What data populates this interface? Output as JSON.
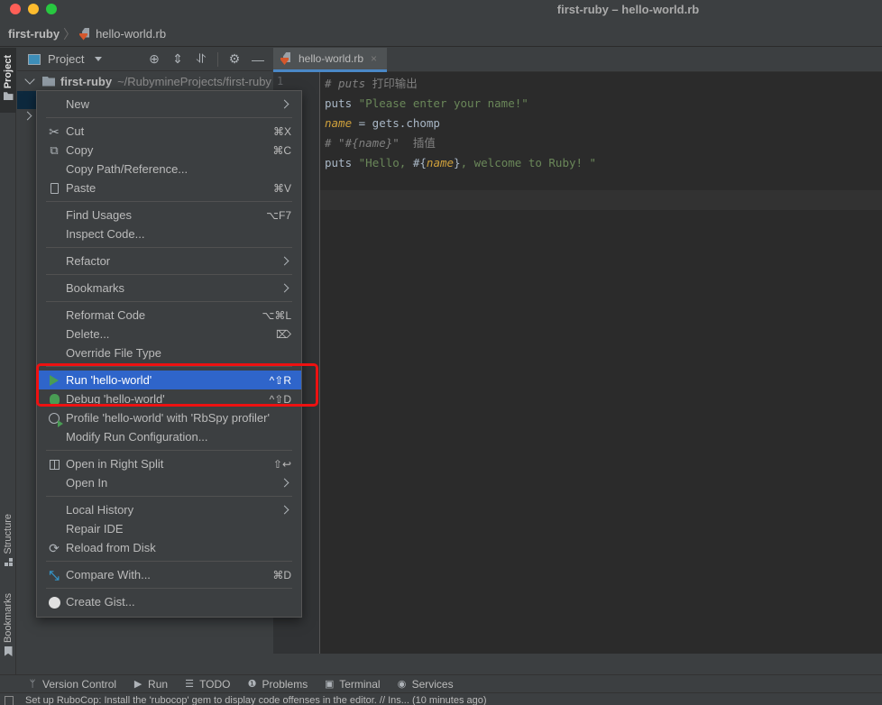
{
  "window": {
    "title": "first-ruby – hello-world.rb"
  },
  "breadcrumb": {
    "project": "first-ruby",
    "separator": "〉",
    "file": "hello-world.rb"
  },
  "left_stripe": {
    "tabs": [
      {
        "label": "Project",
        "icon": "folder-icon",
        "active": true
      },
      {
        "label": "Structure",
        "icon": "structure-icon",
        "active": false
      },
      {
        "label": "Bookmarks",
        "icon": "bookmark-icon",
        "active": false
      }
    ]
  },
  "project_panel": {
    "title": "Project",
    "tools": [
      "locate-icon",
      "expand-all-icon",
      "collapse-all-icon",
      "gear-icon",
      "hide-icon"
    ],
    "root": {
      "name": "first-ruby",
      "path": "~/RubymineProjects/first-ruby"
    }
  },
  "editor": {
    "tab_label": "hello-world.rb",
    "close_glyph": "×",
    "line_number": "1",
    "lines": [
      [
        {
          "t": "# puts ",
          "c": "comment"
        },
        {
          "t": "打印输出",
          "c": "comment-cjk"
        }
      ],
      [
        {
          "t": "puts ",
          "c": "kw"
        },
        {
          "t": "\"Please enter your name!\"",
          "c": "str"
        }
      ],
      [
        {
          "t": "name",
          "c": "var"
        },
        {
          "t": " = gets.chomp",
          "c": "plain"
        }
      ],
      [
        {
          "t": "# \"#{name}\"  ",
          "c": "comment"
        },
        {
          "t": "插值",
          "c": "comment-cjk"
        }
      ],
      [
        {
          "t": "puts ",
          "c": "kw"
        },
        {
          "t": "\"Hello, ",
          "c": "str"
        },
        {
          "t": "#{",
          "c": "plain"
        },
        {
          "t": "name",
          "c": "var"
        },
        {
          "t": "}",
          "c": "plain"
        },
        {
          "t": ", welcome to Ruby! \"",
          "c": "str"
        }
      ]
    ]
  },
  "context_menu": {
    "items": [
      {
        "type": "item",
        "label": "New",
        "submenu": true
      },
      {
        "type": "sep"
      },
      {
        "type": "item",
        "label": "Cut",
        "shortcut": "⌘X",
        "icon": "scissors-icon"
      },
      {
        "type": "item",
        "label": "Copy",
        "shortcut": "⌘C",
        "icon": "copy-icon"
      },
      {
        "type": "item",
        "label": "Copy Path/Reference..."
      },
      {
        "type": "item",
        "label": "Paste",
        "shortcut": "⌘V",
        "icon": "paste-icon"
      },
      {
        "type": "sep"
      },
      {
        "type": "item",
        "label": "Find Usages",
        "shortcut": "⌥F7"
      },
      {
        "type": "item",
        "label": "Inspect Code..."
      },
      {
        "type": "sep"
      },
      {
        "type": "item",
        "label": "Refactor",
        "submenu": true
      },
      {
        "type": "sep"
      },
      {
        "type": "item",
        "label": "Bookmarks",
        "submenu": true
      },
      {
        "type": "sep"
      },
      {
        "type": "item",
        "label": "Reformat Code",
        "shortcut": "⌥⌘L"
      },
      {
        "type": "item",
        "label": "Delete...",
        "shortcut": "⌦"
      },
      {
        "type": "item",
        "label": "Override File Type"
      },
      {
        "type": "sep"
      },
      {
        "type": "item",
        "label": "Run 'hello-world'",
        "shortcut": "^⇧R",
        "icon": "run-icon",
        "selected": true
      },
      {
        "type": "item",
        "label": "Debug 'hello-world'",
        "shortcut": "^⇧D",
        "icon": "debug-icon"
      },
      {
        "type": "item",
        "label": "Profile 'hello-world' with 'RbSpy profiler'",
        "icon": "profile-icon"
      },
      {
        "type": "item",
        "label": "Modify Run Configuration..."
      },
      {
        "type": "sep"
      },
      {
        "type": "item",
        "label": "Open in Right Split",
        "shortcut": "⇧↩",
        "icon": "split-icon"
      },
      {
        "type": "item",
        "label": "Open In",
        "submenu": true
      },
      {
        "type": "sep"
      },
      {
        "type": "item",
        "label": "Local History",
        "submenu": true
      },
      {
        "type": "item",
        "label": "Repair IDE"
      },
      {
        "type": "item",
        "label": "Reload from Disk",
        "icon": "reload-icon"
      },
      {
        "type": "sep"
      },
      {
        "type": "item",
        "label": "Compare With...",
        "shortcut": "⌘D",
        "icon": "compare-icon"
      },
      {
        "type": "sep"
      },
      {
        "type": "item",
        "label": "Create Gist...",
        "icon": "github-icon"
      }
    ]
  },
  "tool_windows": [
    {
      "label": "Version Control",
      "icon": "vcs-icon",
      "glyph": "ᛘ"
    },
    {
      "label": "Run",
      "icon": "run-icon",
      "glyph": "▶"
    },
    {
      "label": "TODO",
      "icon": "todo-icon",
      "glyph": "☰"
    },
    {
      "label": "Problems",
      "icon": "problems-icon",
      "glyph": "❶"
    },
    {
      "label": "Terminal",
      "icon": "terminal-icon",
      "glyph": "▣"
    },
    {
      "label": "Services",
      "icon": "services-icon",
      "glyph": "◉"
    }
  ],
  "status_bar": {
    "message": "Set up RuboCop: Install the 'rubocop' gem to display code offenses in the editor. // Ins... (10 minutes ago)"
  },
  "colors": {
    "selection": "#2f65ca",
    "annotation_box": "#ee1111",
    "run_green": "#499c54",
    "tab_underline": "#4a88c7"
  }
}
